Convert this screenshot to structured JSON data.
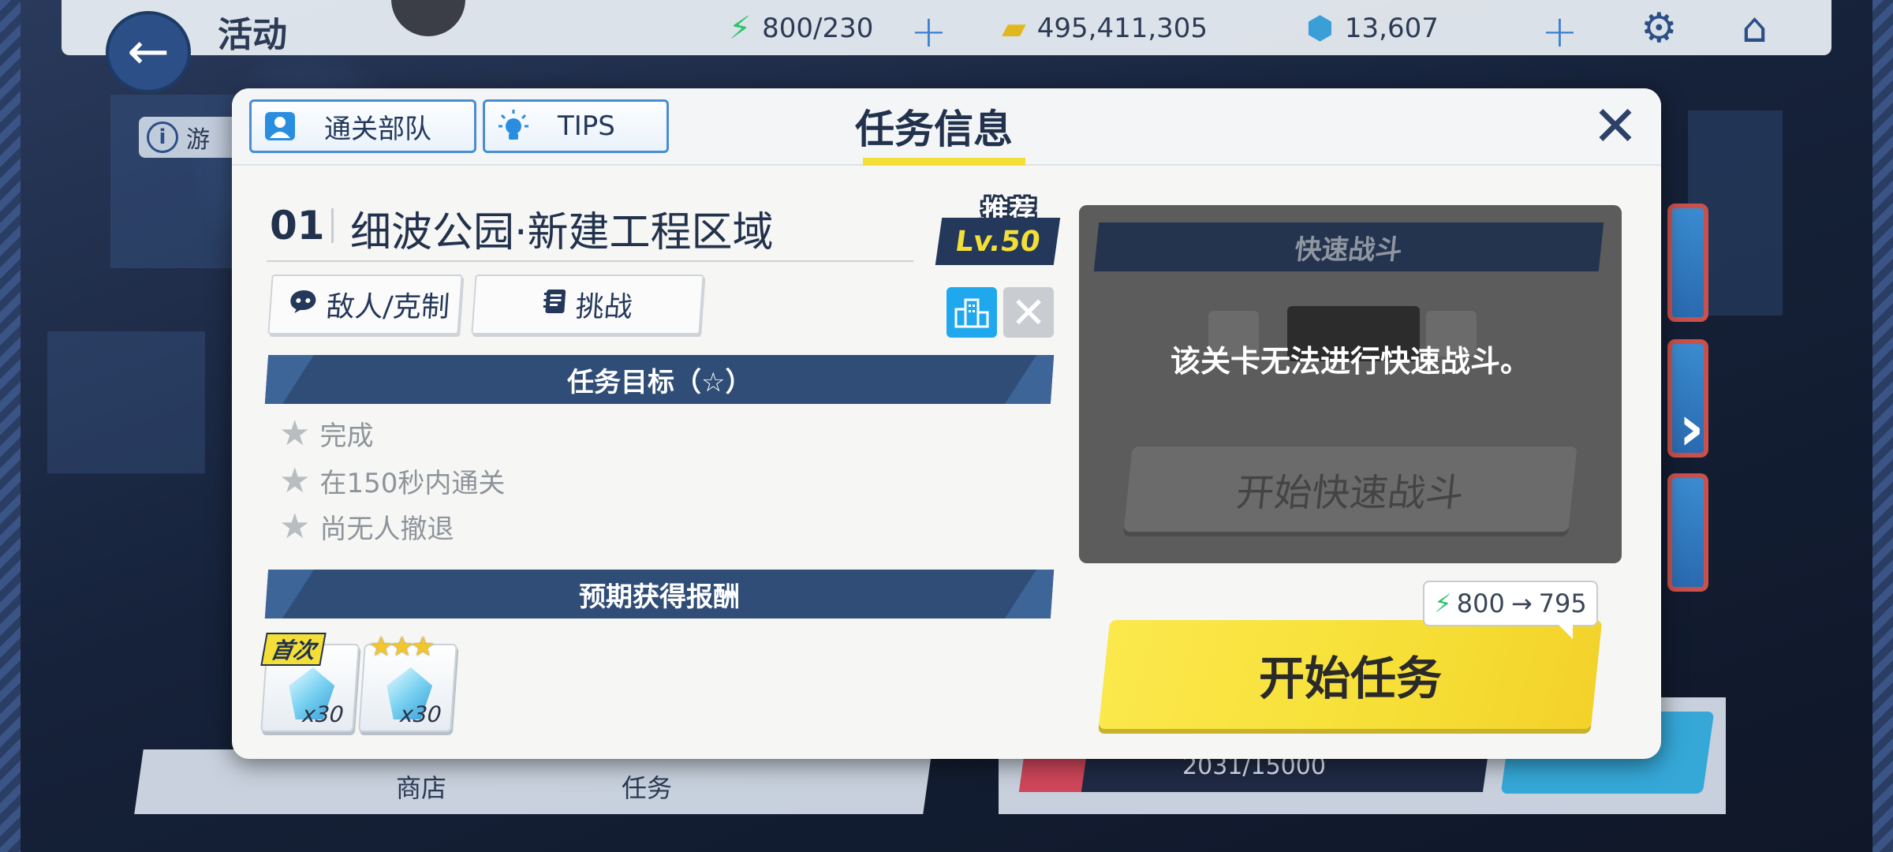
{
  "topbar": {
    "title": "活动",
    "stamina": "800/230",
    "credits": "495,411,305",
    "gems": "13,607",
    "back_icon": "back-arrow-icon",
    "settings_icon": "gear-icon",
    "home_icon": "home-icon"
  },
  "background": {
    "info_text": "游",
    "bottom_tabs": [
      "商店",
      "任务"
    ],
    "progress_text": "2031/15000",
    "progress_fraction": 0.135
  },
  "modal": {
    "tabs": [
      {
        "label": "通关部队",
        "icon": "user-card-icon"
      },
      {
        "label": "TIPS",
        "icon": "lightbulb-icon"
      }
    ],
    "title": "任务信息",
    "stage": {
      "number": "01",
      "name": "细波公园·新建工程区域",
      "recommend_label": "推荐",
      "recommend_level": "Lv.50"
    },
    "sub_buttons": [
      {
        "label": "敌人/克制",
        "icon": "chat-icon"
      },
      {
        "label": "挑战",
        "icon": "notebook-icon"
      }
    ],
    "objectives_title": "任务目标（☆）",
    "objectives": [
      "完成",
      "在150秒内通关",
      "尚无人撤退"
    ],
    "rewards_title": "预期获得报酬",
    "rewards": [
      {
        "badge": "首次",
        "qty": "x30",
        "icon": "gem-icon"
      },
      {
        "badge": "★★★",
        "qty": "x30",
        "icon": "gem-icon"
      }
    ],
    "quick_battle": {
      "title": "快速战斗",
      "message": "该关卡无法进行快速战斗。",
      "button": "开始快速战斗"
    },
    "cost": {
      "from": "800",
      "to": "795"
    },
    "start_button": "开始任务"
  },
  "colors": {
    "accent_yellow": "#f3df38",
    "navy": "#2f4d77",
    "tab_border": "#4a8ed0",
    "start_yellow": "#f6df36"
  }
}
